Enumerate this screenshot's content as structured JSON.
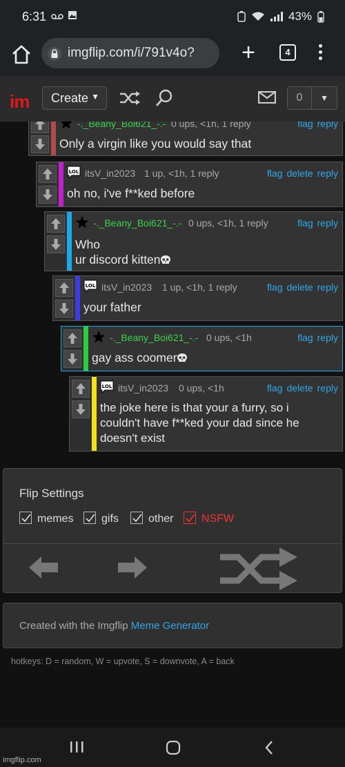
{
  "status_bar": {
    "time": "6:31",
    "battery": "43%"
  },
  "browser": {
    "url": "imgflip.com/i/791v4o?",
    "tab_count": "4"
  },
  "nav": {
    "logo": "im",
    "create_label": "Create",
    "notifications_count": "0"
  },
  "comments": [
    {
      "username": "-._Beany_Boi621_-.-",
      "meta": "0 ups, <1h, 1 reply",
      "actions": [
        "flag",
        "reply"
      ],
      "text": "Only a virgin like you would say that",
      "bar_color": "#b14c4c",
      "avatar": "star-icon"
    },
    {
      "username": "itsV_in2023",
      "meta": "1 up, <1h, 1 reply",
      "actions": [
        "flag",
        "delete",
        "reply"
      ],
      "text": "oh no, i've f**ked before",
      "bar_color": "#c21fd1",
      "avatar": "lol-bubble-icon"
    },
    {
      "username": "-._Beany_Boi621_-.-",
      "meta": "0 ups, <1h, 1 reply",
      "actions": [
        "flag",
        "reply"
      ],
      "text_lines": [
        "Who",
        "ur discord kitten"
      ],
      "bar_color": "#1fa8e8",
      "avatar": "star-icon"
    },
    {
      "username": "itsV_in2023",
      "meta": "1 up, <1h, 1 reply",
      "actions": [
        "flag",
        "delete",
        "reply"
      ],
      "text": "your father",
      "bar_color": "#3c3ce0",
      "avatar": "lol-bubble-icon"
    },
    {
      "username": "-._Beany_Boi621_-.-",
      "meta": "0 ups, <1h",
      "actions": [
        "flag",
        "reply"
      ],
      "text": "gay ass coomer",
      "bar_color": "#2ecc40",
      "avatar": "star-icon"
    },
    {
      "username": "itsV_in2023",
      "meta": "0 ups, <1h",
      "actions": [
        "flag",
        "delete",
        "reply"
      ],
      "text_lines": [
        "the joke here is that your a furry, so i",
        "couldn't have f**ked your dad since he",
        "doesn't exist"
      ],
      "bar_color": "#f2e21b",
      "avatar": "lol-bubble-icon"
    }
  ],
  "flip_settings": {
    "title": "Flip Settings",
    "options": [
      {
        "label": "memes",
        "checked": true
      },
      {
        "label": "gifs",
        "checked": true
      },
      {
        "label": "other",
        "checked": true
      },
      {
        "label": "NSFW",
        "checked": true,
        "color": "#e33333"
      }
    ]
  },
  "credit": {
    "prefix": "Created with the Imgflip ",
    "link": "Meme Generator"
  },
  "hotkeys": "hotkeys: D = random, W = upvote, S = downvote, A = back",
  "watermark": "imgflip.com",
  "colors": {
    "link": "#2fa7ea",
    "username_green": "#3bd34d",
    "brand_red": "#e1171e"
  }
}
